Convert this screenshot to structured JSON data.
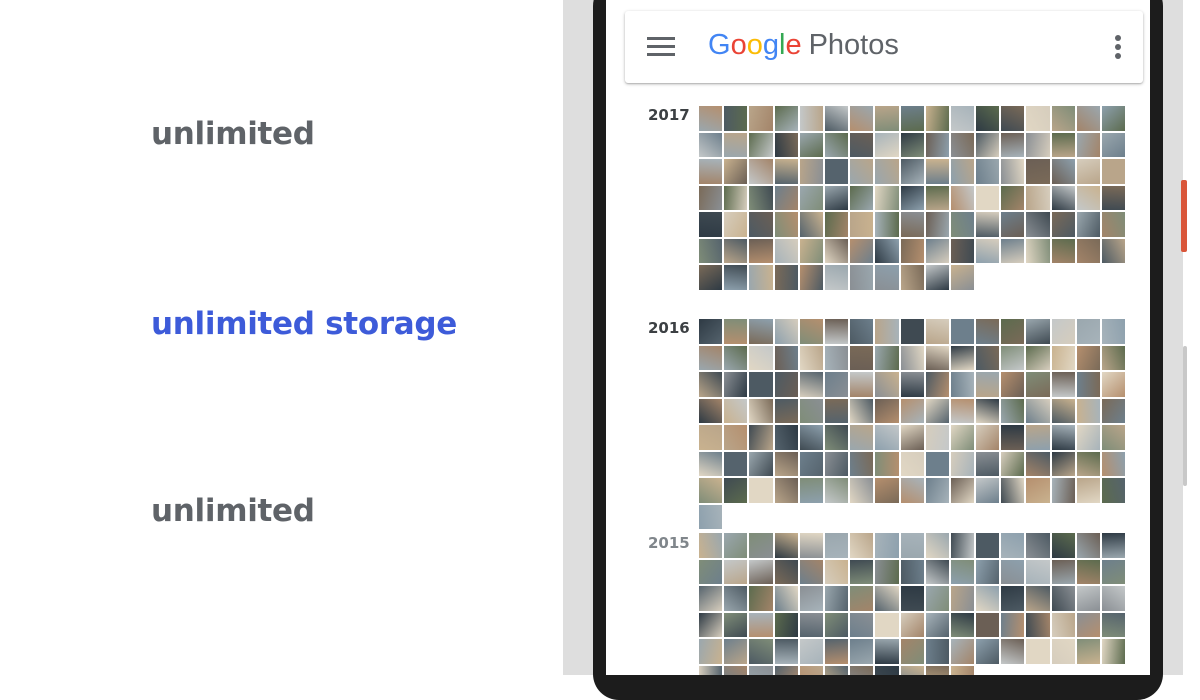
{
  "left_copy": [
    "unlimited",
    "unlimited storage",
    "unlimited"
  ],
  "app": {
    "logo_letters": [
      {
        "ch": "G",
        "color": "#4285F4"
      },
      {
        "ch": "o",
        "color": "#EA4335"
      },
      {
        "ch": "o",
        "color": "#FBBC05"
      },
      {
        "ch": "g",
        "color": "#4285F4"
      },
      {
        "ch": "l",
        "color": "#34A853"
      },
      {
        "ch": "e",
        "color": "#EA4335"
      }
    ],
    "product_name": "Photos",
    "menu_icon": "menu-icon",
    "more_icon": "more-vert-icon"
  },
  "sections": [
    {
      "year": "2017",
      "photo_count": 113
    },
    {
      "year": "2016",
      "photo_count": 120
    },
    {
      "year": "2015",
      "photo_count": 96
    }
  ],
  "colors": {
    "highlight_text": "#3d5bd9",
    "muted_text": "#5f6368"
  }
}
